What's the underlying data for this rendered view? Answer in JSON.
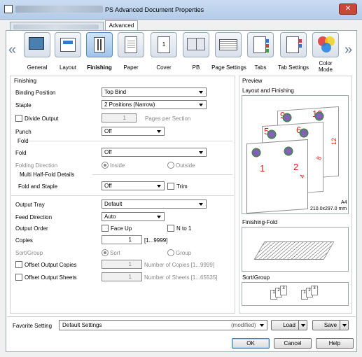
{
  "window": {
    "title": "PS Advanced Document Properties",
    "close_glyph": "✕"
  },
  "tabs": {
    "hidden_tab": "",
    "active_tab": "Advanced"
  },
  "toolbar": {
    "items": [
      {
        "label": "General",
        "icon": "general-icon"
      },
      {
        "label": "Layout",
        "icon": "layout-icon"
      },
      {
        "label": "Finishing",
        "icon": "finishing-icon",
        "selected": true
      },
      {
        "label": "Paper",
        "icon": "paper-icon"
      },
      {
        "label": "Cover",
        "icon": "cover-icon"
      },
      {
        "label": "PB",
        "icon": "pb-icon"
      },
      {
        "label": "Page Settings",
        "icon": "page-settings-icon"
      },
      {
        "label": "Tabs",
        "icon": "tabs-icon"
      },
      {
        "label": "Tab Settings",
        "icon": "tab-settings-icon"
      },
      {
        "label": "Color\nMode",
        "icon": "color-mode-icon"
      }
    ],
    "left_arrow": "«",
    "right_arrow": "»"
  },
  "finishing": {
    "section_title": "Finishing",
    "binding_position_label": "Binding Position",
    "binding_position_value": "Top Bind",
    "staple_label": "Staple",
    "staple_value": "2 Positions (Narrow)",
    "divide_output_label": "Divide Output",
    "divide_output_count": "1",
    "pages_per_section_label": "Pages per Section",
    "punch_label": "Punch",
    "punch_value": "Off",
    "fold_group_label": "Fold",
    "fold_label": "Fold",
    "fold_value": "Off",
    "folding_direction_label": "Folding Direction",
    "inside_label": "Inside",
    "outside_label": "Outside",
    "multi_half_fold_label": "Multi Half-Fold Details",
    "fold_and_staple_label": "Fold and Staple",
    "fold_and_staple_value": "Off",
    "trim_label": "Trim",
    "output_tray_label": "Output Tray",
    "output_tray_value": "Default",
    "feed_direction_label": "Feed Direction",
    "feed_direction_value": "Auto",
    "output_order_label": "Output Order",
    "face_up_label": "Face Up",
    "n_to_1_label": "N to 1",
    "copies_label": "Copies",
    "copies_value": "1",
    "copies_range": "[1...9999]",
    "sort_group_label": "Sort/Group",
    "sort_label": "Sort",
    "group_label": "Group",
    "offset_copies_label": "Offset Output Copies",
    "offset_copies_value": "1",
    "offset_copies_range": "Number of Copies [1...9999]",
    "offset_sheets_label": "Offset Output Sheets",
    "offset_sheets_value": "1",
    "offset_sheets_range": "Number of Sheets [1...65535]"
  },
  "preview": {
    "title": "Preview",
    "layout_label": "Layout and Finishing",
    "page_numbers": [
      "9",
      "10",
      "5",
      "6",
      "1",
      "2",
      "12",
      "8",
      "4"
    ],
    "paper_size": "A4",
    "paper_dims": "210.0x297.0 mm",
    "finishing_fold_label": "Finishing-Fold",
    "sort_group_label": "Sort/Group",
    "sort_nums": [
      "1",
      "2",
      "3",
      "1",
      "2",
      "3"
    ]
  },
  "footer": {
    "favorite_label": "Favorite Setting",
    "favorite_value": "Default Settings",
    "modified": "(modified)",
    "load_label": "Load",
    "save_label": "Save",
    "ok_label": "OK",
    "cancel_label": "Cancel",
    "help_label": "Help"
  }
}
